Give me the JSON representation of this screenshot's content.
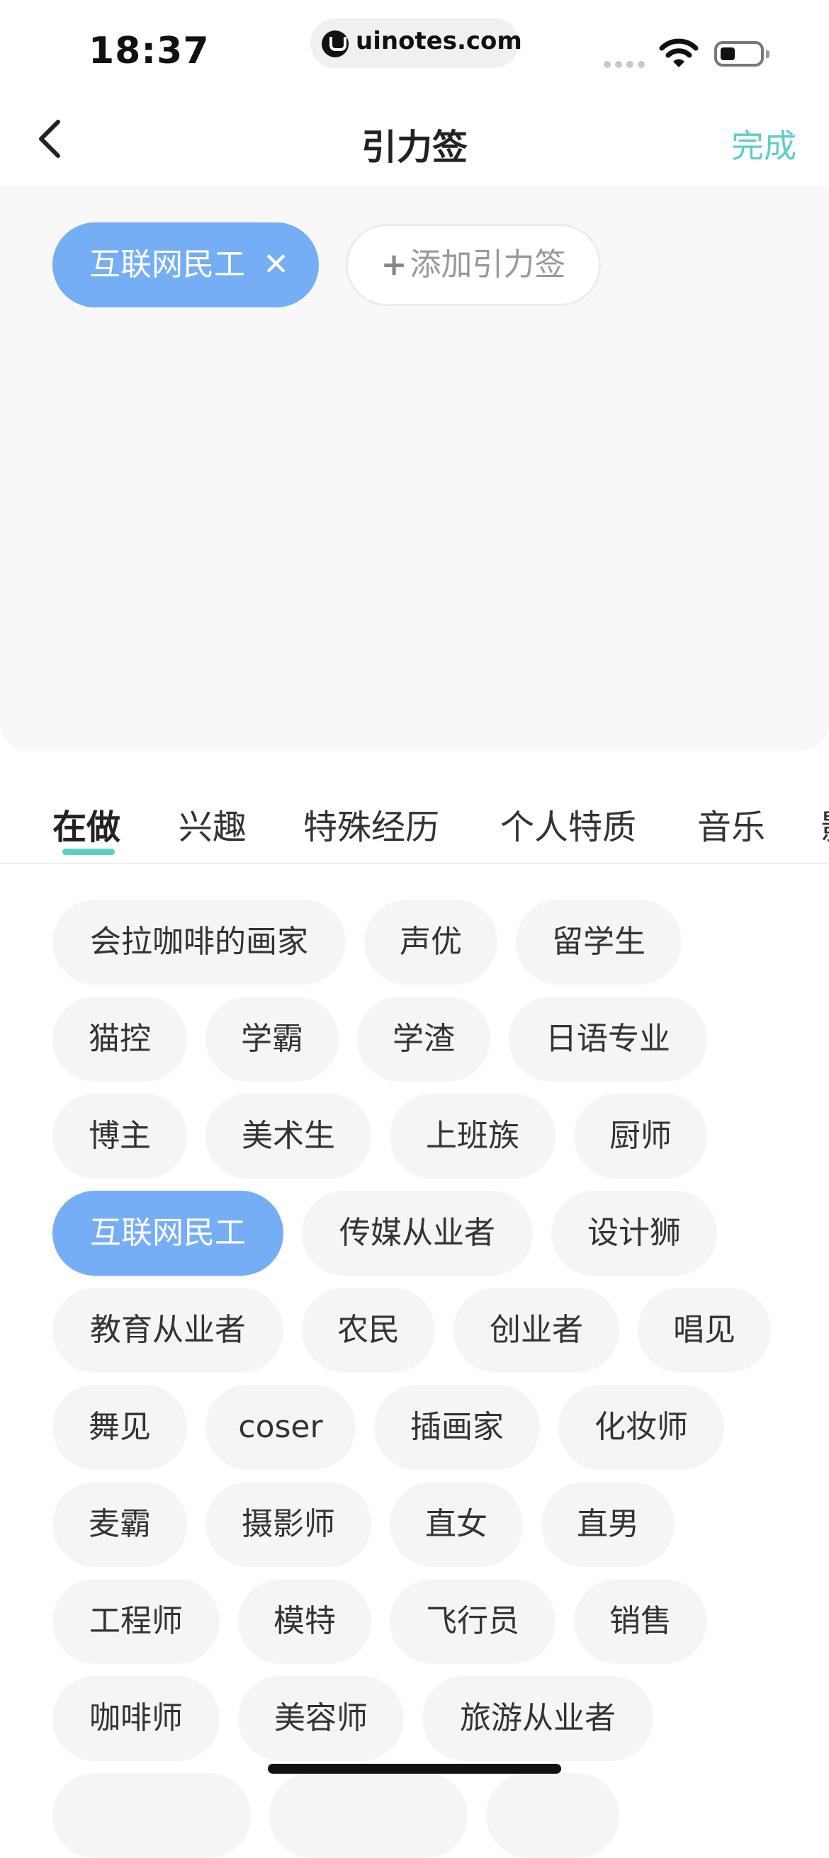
{
  "status_bar": {
    "time": "18:37",
    "url": "uinotes.com"
  },
  "nav": {
    "title": "引力签",
    "done_label": "完成"
  },
  "selected_tags": [
    {
      "label": "互联网民工",
      "remove_glyph": "✕"
    }
  ],
  "add_tag_label": "添加引力签",
  "add_tag_plus": "+",
  "tabs": [
    "在做",
    "兴趣",
    "特殊经历",
    "个人特质",
    "音乐",
    "影"
  ],
  "active_tab": "在做",
  "tag_rows": [
    [
      "会拉咖啡的画家",
      "声优",
      "留学生"
    ],
    [
      "猫控",
      "学霸",
      "学渣",
      "日语专业"
    ],
    [
      "博主",
      "美术生",
      "上班族",
      "厨师"
    ],
    [
      "互联网民工",
      "传媒从业者",
      "设计狮"
    ],
    [
      "教育从业者",
      "农民",
      "创业者",
      "唱见"
    ],
    [
      "舞见",
      "coser",
      "插画家",
      "化妆师"
    ],
    [
      "麦霸",
      "摄影师",
      "直女",
      "直男"
    ],
    [
      "工程师",
      "模特",
      "飞行员",
      "销售"
    ],
    [
      "咖啡师",
      "美容师",
      "旅游从业者"
    ]
  ],
  "selected_tag_in_list": "互联网民工",
  "colors": {
    "accent": "#5ccfc5",
    "selected_chip": "#75aef4",
    "chip_bg": "#f5f5f5",
    "panel_bg": "#f8f8f8"
  },
  "icons": [
    "back-chevron-icon",
    "wifi-icon",
    "battery-icon",
    "close-icon",
    "plus-icon"
  ]
}
